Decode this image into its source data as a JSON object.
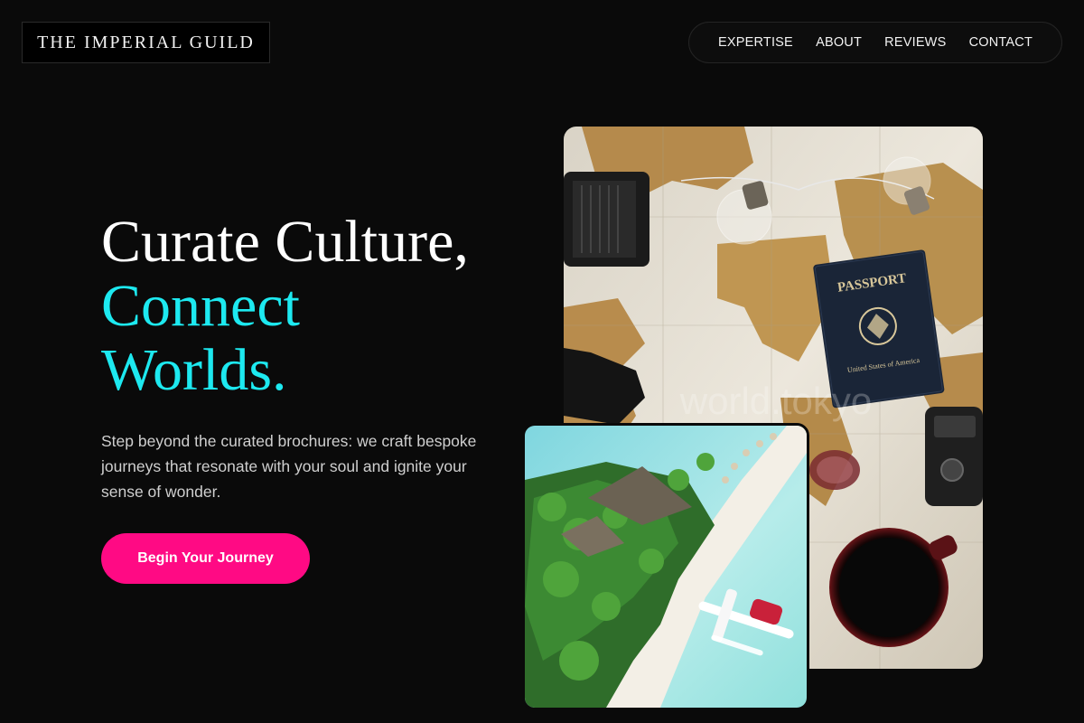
{
  "brand": {
    "name": "THE IMPERIAL GUILD"
  },
  "nav": {
    "items": [
      {
        "label": "EXPERTISE"
      },
      {
        "label": "ABOUT"
      },
      {
        "label": "REVIEWS"
      },
      {
        "label": "CONTACT"
      }
    ]
  },
  "hero": {
    "title_line1": "Curate Culture,",
    "title_line2": "Connect",
    "title_line3": "Worlds.",
    "subtitle": "Step beyond the curated brochures: we craft bespoke journeys that resonate with your soul and ignite your sense of wonder.",
    "cta_label": "Begin Your Journey"
  },
  "images": {
    "map_photo": {
      "passport_text": "PASSPORT",
      "passport_country": "United States of America",
      "watermark": "world.tokyo"
    },
    "island_photo": {}
  },
  "colors": {
    "background": "#0a0a0a",
    "accent_cyan": "#1de9f0",
    "accent_pink": "#ff0a84"
  }
}
